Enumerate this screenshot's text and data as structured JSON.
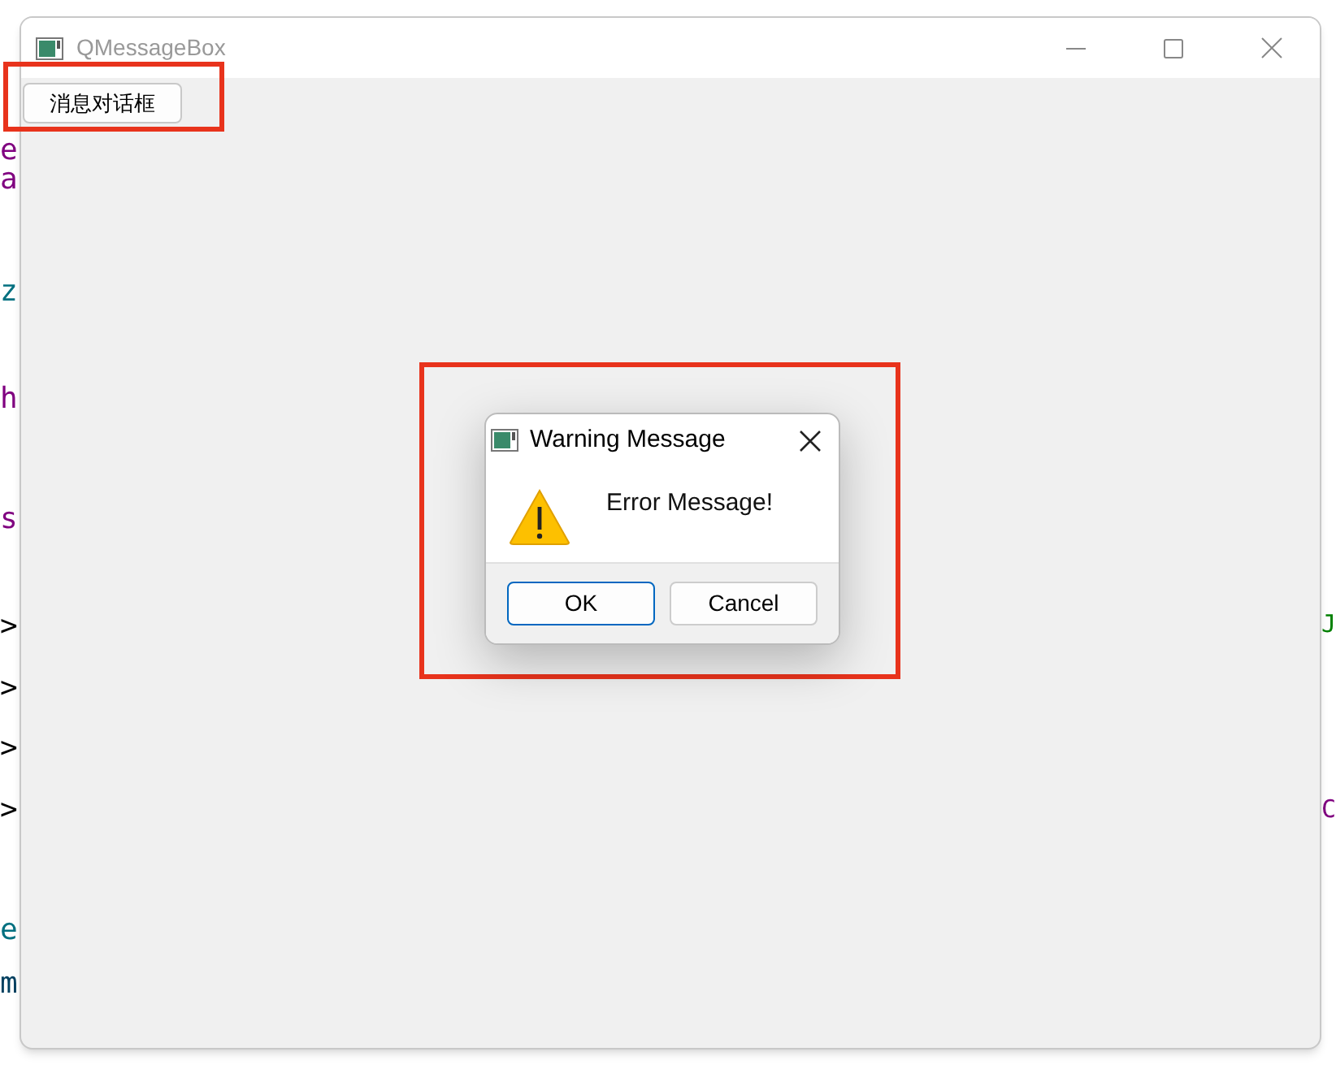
{
  "background_code": {
    "left": [
      {
        "text": "e",
        "color": "#800080"
      },
      {
        "text": "a",
        "color": "#800080"
      },
      {
        "text": "z",
        "color": "#007080"
      },
      {
        "text": "h",
        "color": "#800080"
      },
      {
        "text": "s",
        "color": "#800080"
      },
      {
        "text": ">",
        "color": "#000000"
      },
      {
        "text": ">",
        "color": "#000000"
      },
      {
        "text": ">",
        "color": "#000000"
      },
      {
        "text": ">",
        "color": "#000000"
      },
      {
        "text": "e",
        "color": "#007080"
      },
      {
        "text": "m",
        "color": "#004060"
      }
    ],
    "right": [
      {
        "text": "J",
        "color": "#008000"
      },
      {
        "text": "C",
        "color": "#800080"
      }
    ]
  },
  "window": {
    "title": "QMessageBox",
    "button": "消息对话框"
  },
  "dialog": {
    "title": "Warning Message",
    "message": "Error Message!",
    "buttons": [
      {
        "label": "OK",
        "selected": true
      },
      {
        "label": "Cancel",
        "selected": false
      }
    ]
  }
}
